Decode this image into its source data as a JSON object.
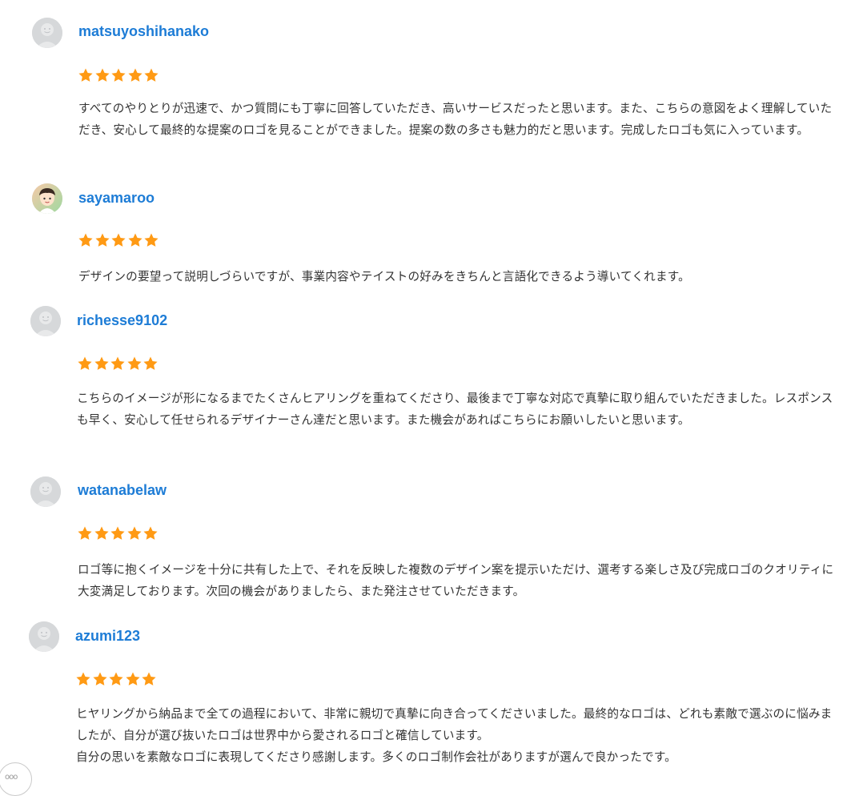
{
  "colors": {
    "username": "#1d7cd6",
    "star": "#ff9a14",
    "text": "#333333",
    "avatar_default": "#d6d8da"
  },
  "star_icon": "star-icon",
  "reviews": [
    {
      "username": "matsuyoshihanako",
      "avatar": "default-avatar-icon",
      "rating": 5,
      "text": "すべてのやりとりが迅速で、かつ質問にも丁寧に回答していただき、高いサービスだったと思います。また、こちらの意図をよく理解していただき、安心して最終的な提案のロゴを見ることができました。提案の数の多さも魅力的だと思います。完成したロゴも気に入っています。"
    },
    {
      "username": "sayamaroo",
      "avatar": "illustrated-avatar-icon",
      "rating": 5,
      "text": "デザインの要望って説明しづらいですが、事業内容やテイストの好みをきちんと言語化できるよう導いてくれます。"
    },
    {
      "username": "richesse9102",
      "avatar": "default-avatar-icon",
      "rating": 5,
      "text": "こちらのイメージが形になるまでたくさんヒアリングを重ねてくださり、最後まで丁寧な対応で真摯に取り組んでいただきました。レスポンスも早く、安心して任せられるデザイナーさん達だと思います。また機会があればこちらにお願いしたいと思います。"
    },
    {
      "username": "watanabelaw",
      "avatar": "default-avatar-icon",
      "rating": 5,
      "text": "ロゴ等に抱くイメージを十分に共有した上で、それを反映した複数のデザイン案を提示いただけ、選考する楽しさ及び完成ロゴのクオリティに大変満足しております。次回の機会がありましたら、また発注させていただきます。"
    },
    {
      "username": "azumi123",
      "avatar": "default-avatar-icon",
      "rating": 5,
      "text": "ヒヤリングから納品まで全ての過程において、非常に親切で真摯に向き合ってくださいました。最終的なロゴは、どれも素敵で選ぶのに悩みましたが、自分が選び抜いたロゴは世界中から愛されるロゴと確信しています。\n自分の思いを素敵なロゴに表現してくださり感謝します。多くのロゴ制作会社がありますが選んで良かったです。"
    }
  ],
  "more_button": {
    "icon": "more-dots-icon",
    "label": "ooo"
  }
}
